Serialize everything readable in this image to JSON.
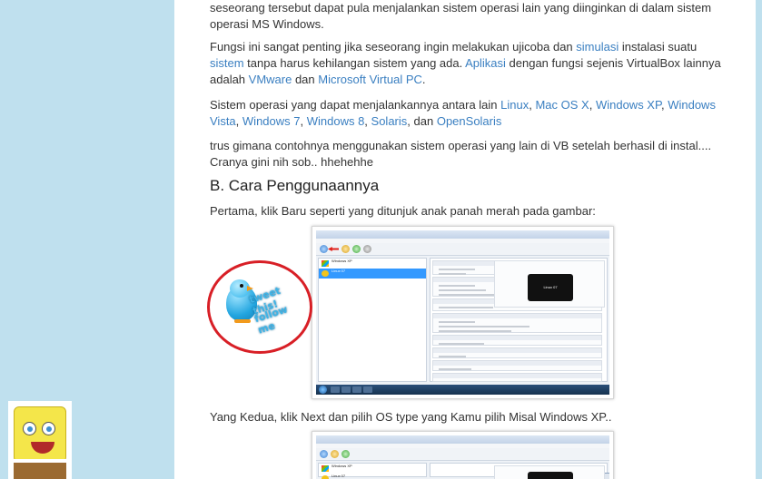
{
  "article": {
    "p1": "seseorang tersebut dapat pula menjalankan sistem operasi lain yang diinginkan di dalam sistem operasi MS Windows.",
    "p2_a": "Fungsi ini sangat penting jika seseorang ingin melakukan ujicoba dan ",
    "p2_link_simulasi": "simulasi",
    "p2_b": " instalasi suatu ",
    "p2_link_sistem": "sistem",
    "p2_c": " tanpa harus kehilangan sistem yang ada. ",
    "p2_link_aplikasi": "Aplikasi",
    "p2_d": " dengan fungsi sejenis VirtualBox lainnya adalah ",
    "p2_link_vmware": "VMware",
    "p2_e": " dan ",
    "p2_link_mvpc": "Microsoft Virtual PC",
    "p2_f": ".",
    "p3_a": "Sistem operasi yang dapat menjalankannya antara lain ",
    "p3_links": [
      "Linux",
      "Mac OS X",
      "Windows XP",
      "Windows Vista",
      "Windows 7",
      "Windows 8",
      "Solaris",
      "OpenSolaris"
    ],
    "p3_and": "dan",
    "p4": "trus gimana contohnya menggunakan sistem operasi yang lain di VB setelah berhasil di instal.... Cranya gini nih sob.. hhehehhe",
    "heading": "B. Cara Penggunaannya",
    "p5": "Pertama, klik Baru seperti yang ditunjuk anak panah merah pada gambar:",
    "p6": "Yang Kedua, klik Next dan pilih OS type yang Kamu pilih Misal Windows XP.."
  },
  "screenshot1": {
    "vm_list": [
      "Windows XP",
      "Linux 07"
    ],
    "preview_label": "Linux 07"
  },
  "screenshot2": {
    "vm_list": [
      "Windows XP",
      "Linux 07"
    ]
  },
  "badge": {
    "line1": "tweet this!",
    "line2": "follow me"
  },
  "colors": {
    "link": "#3a7fc1",
    "sidebar_bg": "#bfe0ee",
    "badge_ring": "#d81f26",
    "selection": "#3399ff"
  },
  "icons": [
    "twitter-bird-icon",
    "spongebob-widget-icon",
    "virtualbox-icon",
    "windows-start-icon"
  ]
}
